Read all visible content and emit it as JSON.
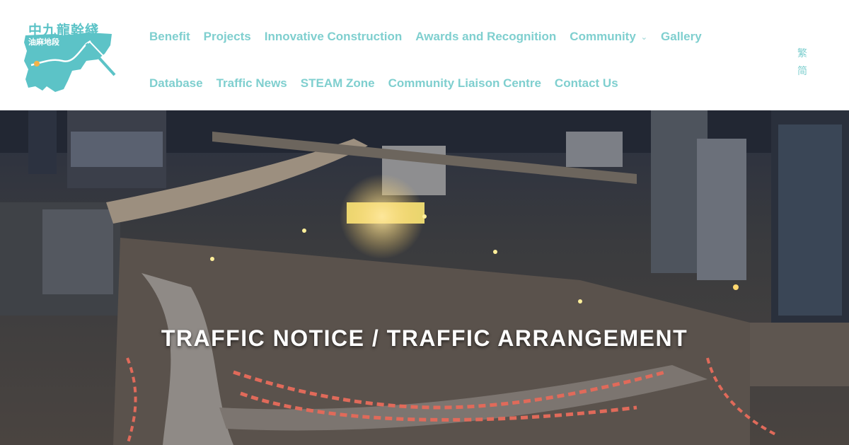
{
  "logo": {
    "title_cn": "中九龍幹綫",
    "subtitle_cn": "油麻地段"
  },
  "nav": {
    "row1": [
      "Benefit",
      "Projects",
      "Innovative Construction",
      "Awards and Recognition",
      "Community",
      "Gallery"
    ],
    "row2": [
      "Database",
      "Traffic News",
      "STEAM Zone",
      "Community Liaison Centre",
      "Contact Us"
    ]
  },
  "lang": {
    "traditional": "繁",
    "simplified": "简"
  },
  "hero": {
    "title": "TRAFFIC NOTICE / TRAFFIC ARRANGEMENT"
  },
  "colors": {
    "accent": "#7fcfcf",
    "logo": "#5cc3c7",
    "hero_text": "#ffffff"
  }
}
